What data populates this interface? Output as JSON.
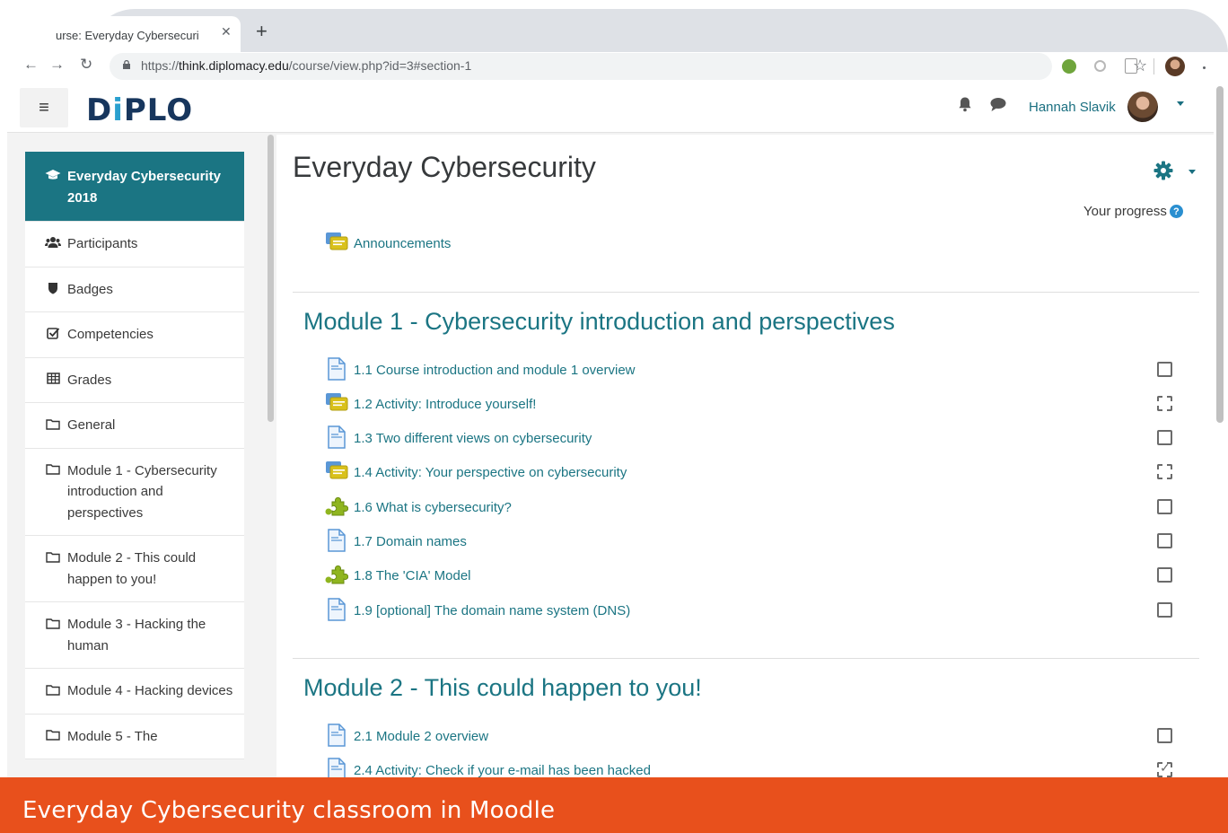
{
  "browser": {
    "tab_title": "urse: Everyday Cybersecuri",
    "url_scheme": "https://",
    "url_host": "think.diplomacy.edu",
    "url_path": "/course/view.php?id=3#section-1"
  },
  "navbar": {
    "logo_prefix": "D",
    "logo_i": "i",
    "logo_suffix": "PLO",
    "user_name": "Hannah Slavik"
  },
  "sidebar": {
    "items": [
      {
        "label": "Everyday Cybersecurity 2018",
        "icon": "graduation-cap-icon",
        "active": true
      },
      {
        "label": "Participants",
        "icon": "users-icon"
      },
      {
        "label": "Badges",
        "icon": "shield-icon"
      },
      {
        "label": "Competencies",
        "icon": "check-square-icon"
      },
      {
        "label": "Grades",
        "icon": "table-icon"
      },
      {
        "label": "General",
        "icon": "folder-icon"
      },
      {
        "label": "Module 1 - Cybersecurity introduction and perspectives",
        "icon": "folder-icon"
      },
      {
        "label": "Module 2 - This could happen to you!",
        "icon": "folder-icon"
      },
      {
        "label": "Module 3 - Hacking the human",
        "icon": "folder-icon"
      },
      {
        "label": "Module 4 - Hacking devices",
        "icon": "folder-icon"
      },
      {
        "label": "Module 5 - The",
        "icon": "folder-icon"
      }
    ]
  },
  "main": {
    "title": "Everyday Cybersecurity",
    "progress_label": "Your progress",
    "help_glyph": "?",
    "announcements": {
      "label": "Announcements",
      "icon": "forum-icon"
    },
    "sections": [
      {
        "title": "Module 1 - Cybersecurity introduction and perspectives",
        "activities": [
          {
            "label": "1.1 Course introduction and module 1 overview",
            "icon": "page-icon",
            "completion": "manual"
          },
          {
            "label": "1.2 Activity: Introduce yourself!",
            "icon": "forum-icon",
            "completion": "auto"
          },
          {
            "label": "1.3 Two different views on cybersecurity",
            "icon": "page-icon",
            "completion": "manual"
          },
          {
            "label": "1.4 Activity: Your perspective on cybersecurity",
            "icon": "forum-icon",
            "completion": "auto"
          },
          {
            "label": "1.6 What is cybersecurity?",
            "icon": "puzzle-icon",
            "completion": "manual"
          },
          {
            "label": "1.7 Domain names",
            "icon": "page-icon",
            "completion": "manual"
          },
          {
            "label": "1.8 The 'CIA' Model",
            "icon": "puzzle-icon",
            "completion": "manual"
          },
          {
            "label": "1.9 [optional] The domain name system (DNS)",
            "icon": "page-icon",
            "completion": "manual"
          }
        ]
      },
      {
        "title": "Module 2 - This could happen to you!",
        "activities": [
          {
            "label": "2.1 Module 2 overview",
            "icon": "page-icon",
            "completion": "manual"
          },
          {
            "label": "2.4 Activity: Check if your e-mail has been hacked",
            "icon": "page-icon",
            "completion": "auto-checked"
          }
        ]
      }
    ]
  },
  "caption": {
    "text": "Everyday Cybersecurity classroom in Moodle"
  },
  "colors": {
    "accent": "#1b7583",
    "caption": "#e8501c",
    "logo": "#17365d"
  }
}
